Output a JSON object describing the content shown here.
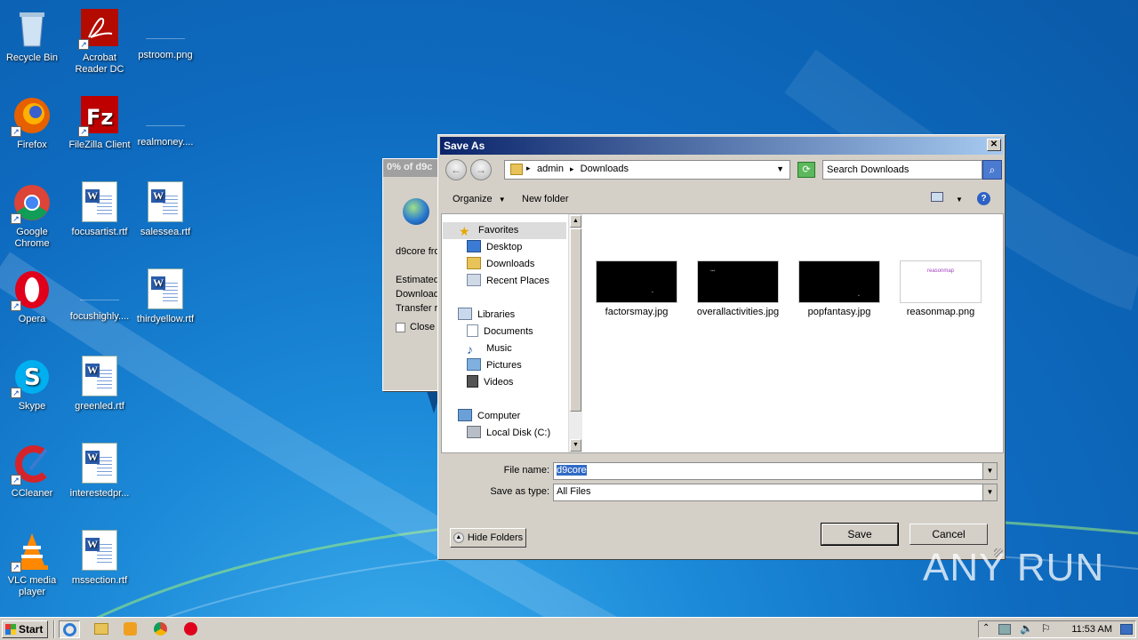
{
  "desktop": {
    "icons": [
      {
        "label": "Recycle Bin"
      },
      {
        "label": "Acrobat Reader DC"
      },
      {
        "label": "pstroom.png"
      },
      {
        "label": "Firefox"
      },
      {
        "label": "FileZilla Client"
      },
      {
        "label": "realmoney...."
      },
      {
        "label": "Google Chrome"
      },
      {
        "label": "focusartist.rtf"
      },
      {
        "label": "salessea.rtf"
      },
      {
        "label": "Opera"
      },
      {
        "label": "focushighly...."
      },
      {
        "label": "thirdyellow.rtf"
      },
      {
        "label": "Skype"
      },
      {
        "label": "greenled.rtf"
      },
      {
        "label": "CCleaner"
      },
      {
        "label": "interestedpr..."
      },
      {
        "label": "VLC media player"
      },
      {
        "label": "mssection.rtf"
      }
    ]
  },
  "progress_window": {
    "title": "0% of d9c",
    "lines": [
      "d9core fro",
      "Estimated",
      "Download",
      "Transfer ra"
    ],
    "close_checkbox": "Close"
  },
  "dialog": {
    "title": "Save As",
    "address": {
      "crumbs": [
        "admin",
        "Downloads"
      ]
    },
    "search_placeholder": "Search Downloads",
    "toolbar": {
      "organize": "Organize",
      "new_folder": "New folder"
    },
    "nav": {
      "favorites": "Favorites",
      "desktop": "Desktop",
      "downloads": "Downloads",
      "recent": "Recent Places",
      "libraries": "Libraries",
      "documents": "Documents",
      "music": "Music",
      "pictures": "Pictures",
      "videos": "Videos",
      "computer": "Computer",
      "local_disk": "Local Disk (C:)"
    },
    "files": [
      {
        "name": "factorsmay.jpg"
      },
      {
        "name": "overallactivities.jpg"
      },
      {
        "name": "popfantasy.jpg"
      },
      {
        "name": "reasonmap.png",
        "thumb_text": "reasonmap"
      }
    ],
    "file_name_label": "File name:",
    "file_name_value": "d9core",
    "save_type_label": "Save as type:",
    "save_type_value": "All Files",
    "hide_folders": "Hide Folders",
    "save": "Save",
    "cancel": "Cancel"
  },
  "taskbar": {
    "start": "Start",
    "clock": "11:53 AM"
  },
  "watermark": "ANY RUN"
}
